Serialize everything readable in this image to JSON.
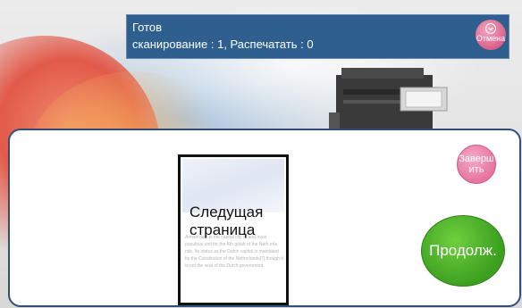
{
  "status": {
    "state": "Готов",
    "counts": "сканирование : 1, Распечатать : 0"
  },
  "buttons": {
    "cancel_label": "Отмена",
    "finish_label": "Заверш ить",
    "continue_label": "Продолж."
  },
  "preview": {
    "next_page_label": "Следущая страница",
    "document_text": "Amsterdam is the capital city of and most populous unit for the Kib golah of the Neth erla nds. Its status as the Dutch capital is mandated by the Constitution of the Netherlands[7] though it is not the seat of the Dutch government."
  },
  "colors": {
    "status_bar": "#2f5f8f",
    "panel_border": "#2f4f7f",
    "finish_button": "#e6749e",
    "continue_button": "#3b9f1f"
  },
  "icons": {
    "cancel": "chevron-down-icon",
    "printer": "printer-icon"
  }
}
